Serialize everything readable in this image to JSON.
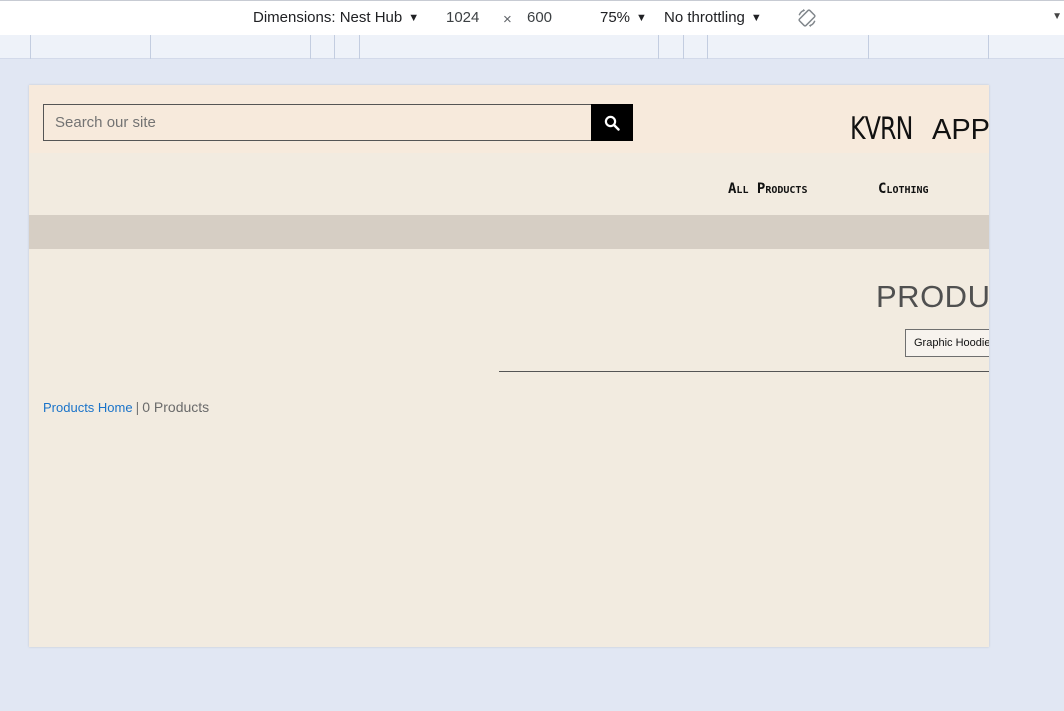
{
  "devtools": {
    "dimensions_label": "Dimensions: Nest Hub",
    "width": "1024",
    "times": "×",
    "height": "600",
    "zoom": "75%",
    "throttling": "No throttling",
    "rotate_icon": "rotate-icon",
    "more_icon": "chevron-down-icon"
  },
  "site": {
    "search": {
      "placeholder": "Search our site",
      "button_icon": "search-icon"
    },
    "logo": {
      "mark": "KVRN",
      "text": "APP"
    },
    "nav": {
      "items": [
        {
          "label": "All Products"
        },
        {
          "label": "Clothing"
        }
      ]
    },
    "page_title": "PRODUC",
    "filter": {
      "selected": "Graphic Hoodie"
    },
    "breadcrumb": {
      "home": "Products Home",
      "separator": "|",
      "count": "0 Products"
    }
  },
  "colors": {
    "header_bg": "#f7eadc",
    "page_bg": "#f2ebe0",
    "promo_bar": "#d6cec4",
    "link": "#1a73c9",
    "search_btn": "#000000"
  }
}
